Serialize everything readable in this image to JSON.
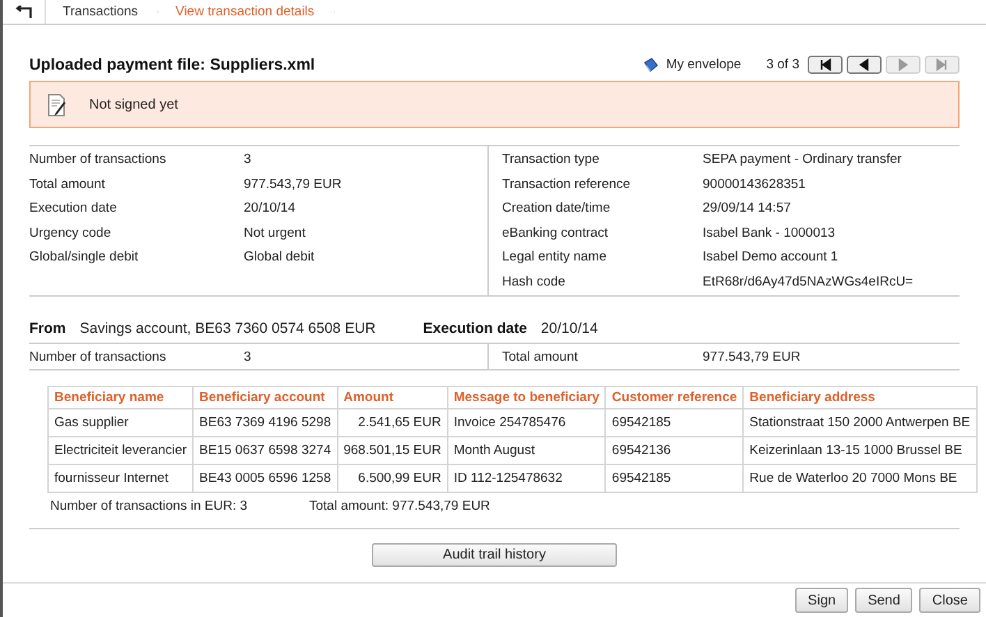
{
  "breadcrumb": [
    {
      "label": "Transactions",
      "selected": false
    },
    {
      "label": "View transaction details",
      "selected": true
    }
  ],
  "title": "Uploaded payment file: Suppliers.xml",
  "envelope": "My envelope",
  "pager": {
    "position": "3 of 3",
    "buttons": [
      {
        "kind": "first",
        "disabled": false
      },
      {
        "kind": "prev",
        "disabled": false
      },
      {
        "kind": "next",
        "disabled": true
      },
      {
        "kind": "last",
        "disabled": true
      }
    ]
  },
  "status": "Not signed yet",
  "details_left": [
    {
      "label": "Number of transactions",
      "value": "3"
    },
    {
      "label": "Total amount",
      "value": "977.543,79 EUR"
    },
    {
      "label": "Execution date",
      "value": "20/10/14"
    },
    {
      "label": "Urgency code",
      "value": "Not urgent"
    },
    {
      "label": "Global/single debit",
      "value": "Global debit"
    }
  ],
  "details_right": [
    {
      "label": "Transaction type",
      "value": "SEPA payment - Ordinary transfer"
    },
    {
      "label": "Transaction reference",
      "value": "90000143628351"
    },
    {
      "label": "Creation date/time",
      "value": "29/09/14 14:57"
    },
    {
      "label": "eBanking contract",
      "value": "Isabel Bank - 1000013"
    },
    {
      "label": "Legal entity name",
      "value": "Isabel Demo account 1"
    },
    {
      "label": "Hash code",
      "value": "EtR68r/d6Ay47d5NAzWGs4eIRcU="
    }
  ],
  "from": {
    "label": "From",
    "value": "Savings account, BE63 7360 0574 6508 EUR",
    "date_label": "Execution date",
    "date": "20/10/14"
  },
  "summary": [
    {
      "label": "Number of transactions",
      "value": "3"
    },
    {
      "label": "Total amount",
      "value": "977.543,79 EUR"
    }
  ],
  "table": {
    "columns": [
      "Beneficiary name",
      "Beneficiary account",
      "Amount",
      "Message to beneficiary",
      "Customer reference",
      "Beneficiary address"
    ],
    "rows": [
      [
        "Gas supplier",
        "BE63 7369 4196 5298",
        "2.541,65 EUR",
        "Invoice 254785476",
        "69542185",
        "Stationstraat 150 2000 Antwerpen BE"
      ],
      [
        "Electriciteit leverancier",
        "BE15 0637 6598 3274",
        "968.501,15 EUR",
        "Month August",
        "69542136",
        "Keizerinlaan 13-15 1000 Brussel BE"
      ],
      [
        "fournisseur Internet",
        "BE43 0005 6596 1258",
        "6.500,99 EUR",
        "ID 112-125478632",
        "69542185",
        "Rue de Waterloo 20 7000 Mons BE"
      ]
    ]
  },
  "table_footer": [
    "Number of transactions in EUR: 3",
    "Total amount: 977.543,79 EUR"
  ],
  "audit_button": "Audit trail history",
  "actions": [
    "Sign",
    "Send",
    "Close"
  ]
}
